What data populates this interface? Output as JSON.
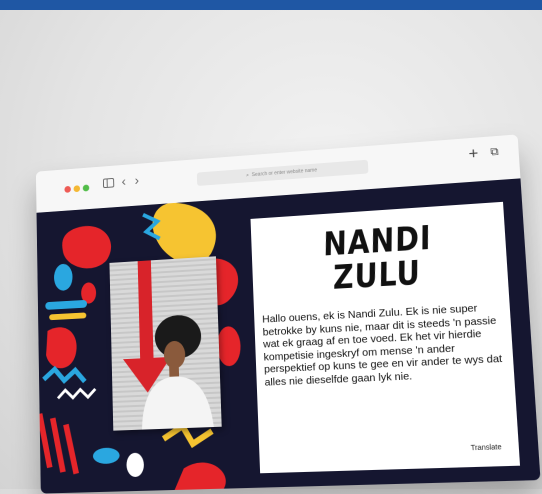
{
  "page": {
    "header_color": "#1f57a4"
  },
  "browser": {
    "traffic_lights": [
      "#ee5b55",
      "#f4b834",
      "#52bd49"
    ],
    "sidebar_icon": "sidebar-icon",
    "back_icon": "‹",
    "forward_icon": "›",
    "search_icon": "⌕",
    "address_placeholder": "Search or enter website name",
    "new_tab_icon": "+",
    "tabs_icon": "⧉"
  },
  "site": {
    "name_line1": "NANDI",
    "name_line2": "ZULU",
    "bio": "Hallo ouens, ek is Nandi Zulu. Ek is nie super betrokke by kuns nie, maar dit is steeds 'n passie wat ek graag af en toe voed. Ek het vir hierdie kompetisie ingeskryf om mense 'n ander perspektief op kuns te gee en vir ander te wys dat alles nie dieselfde gaan lyk nie.",
    "translate_label": "Translate",
    "background_color": "#151630",
    "accent_colors": [
      "#e5252a",
      "#f6c431",
      "#2aa7e0",
      "#ffffff"
    ]
  }
}
